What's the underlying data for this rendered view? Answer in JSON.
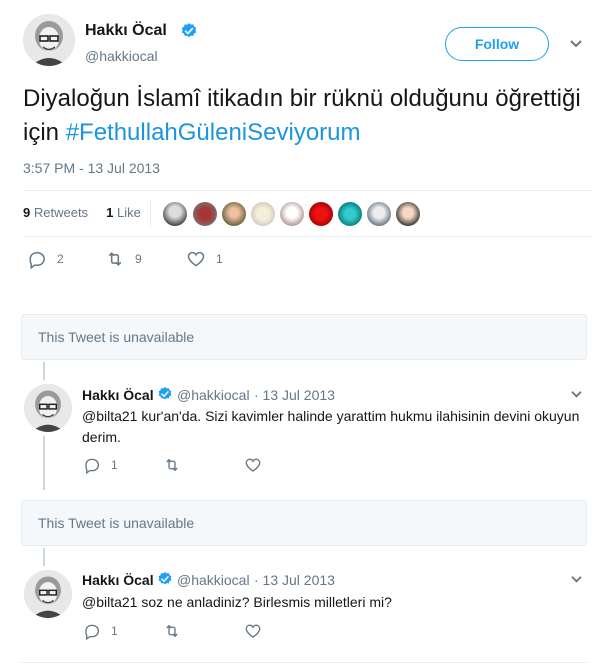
{
  "main_tweet": {
    "display_name": "Hakkı Öcal",
    "handle": "@hakkiocal",
    "follow_label": "Follow",
    "text_plain": "Diyaloğun İslamî itikadın bir rüknü olduğunu öğrettiği için ",
    "hashtag": "#FethullahGüleniSeviyorum",
    "timestamp": "3:57 PM - 13 Jul 2013",
    "retweets_count": "9",
    "retweets_label": "Retweets",
    "likes_count": "1",
    "likes_label": "Like",
    "reply_count": "2",
    "retweet_count": "9",
    "like_count": "1"
  },
  "unavailable_1": "This Tweet is unavailable",
  "unavailable_2": "This Tweet is unavailable",
  "reply_1": {
    "display_name": "Hakkı Öcal",
    "handle": "@hakkiocal",
    "date": "· 13 Jul 2013",
    "text": "@bilta21 kur'an'da. Sizi kavimler halinde yarattim hukmu ilahisinin devini okuyun derim.",
    "reply_count": "1"
  },
  "reply_2": {
    "display_name": "Hakkı Öcal",
    "handle": "@hakkiocal",
    "date": "· 13 Jul 2013",
    "text": "@bilta21 soz ne anladiniz? Birlesmis milletleri mi?",
    "reply_count": "1"
  },
  "colors": {
    "accent": "#1da1f2",
    "hashtag": "#1b95e0",
    "muted": "#657786",
    "unavailable_bg": "#f5f8fa"
  }
}
